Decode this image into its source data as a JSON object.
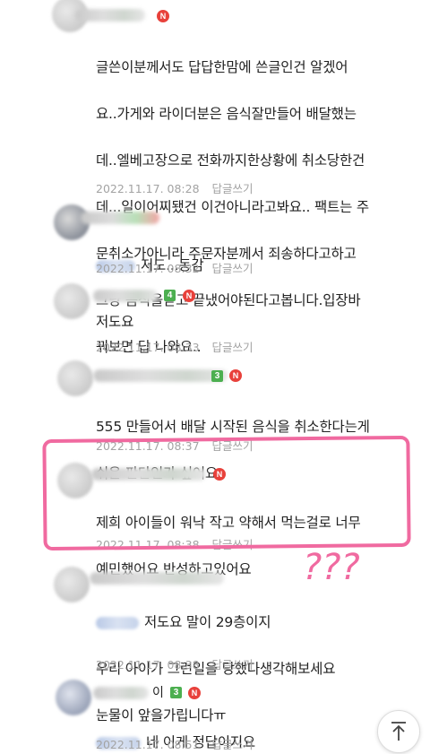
{
  "ui": {
    "reply_label": "답글쓰기",
    "naver_badge": "N",
    "highlight_color": "#f06aa0",
    "question_marks": "???"
  },
  "comments": [
    {
      "text": "글쓴이분께서도 답답한맘에 쓴글인건 알겠어요..가게와 라이더분은 음식잘만들어 배달했는데..엘베고장으로 전화까지한상황에 취소당한건데...일이어찌됐건 이건아니라고봐요.. 팩트는 주문취소가아니라 주문자분께서 죄송하다고하고 그냥 음식을받고 끝냈어야된다고봅니다.입장바꿔보면 답 나와요..",
      "lines": [
        "글쓴이분께서도 답답한맘에 쓴글인건 알겠어",
        "요..가게와 라이더분은 음식잘만들어 배달했는",
        "데..엘베고장으로 전화까지한상황에 취소당한건",
        "데...일이어찌됐건 이건아니라고봐요.. 팩트는 주",
        "문취소가아니라 주문자분께서 죄송하다고하고",
        "그냥 음식을받고 끝냈어야된다고봅니다.입장바",
        "꿔보면 답 나와요.."
      ],
      "timestamp": "2022.11.17. 08:28"
    },
    {
      "text": "저도...동감",
      "timestamp": "2022.11.17. 08:32"
    },
    {
      "level": "4",
      "text": "저도요",
      "timestamp": "2022.11.17. 08:33"
    },
    {
      "level": "3",
      "lines": [
        "555 만들어서 배달 시작된 음식을 취소한다는게",
        "쉬운 판단인가 싶어요"
      ],
      "timestamp": "2022.11.17. 08:37"
    },
    {
      "lines": [
        "제희 아이들이 워낙 작고 약해서 먹는걸로 너무",
        "예민했어요 반성하고있어요"
      ],
      "timestamp": "2022.11.17. 08:38"
    },
    {
      "lines": [
        "저도요 말이 29층이지",
        "우리 아이가 그런일을 당했다생각해보세요",
        "눈물이 앞을가립니다ㅠ"
      ],
      "timestamp": "2022.11.17. 08:38"
    },
    {
      "name_visible": "이",
      "level": "3",
      "text": "네 이게 정답이지요",
      "timestamp": "2022.11.17. 08:51"
    }
  ]
}
